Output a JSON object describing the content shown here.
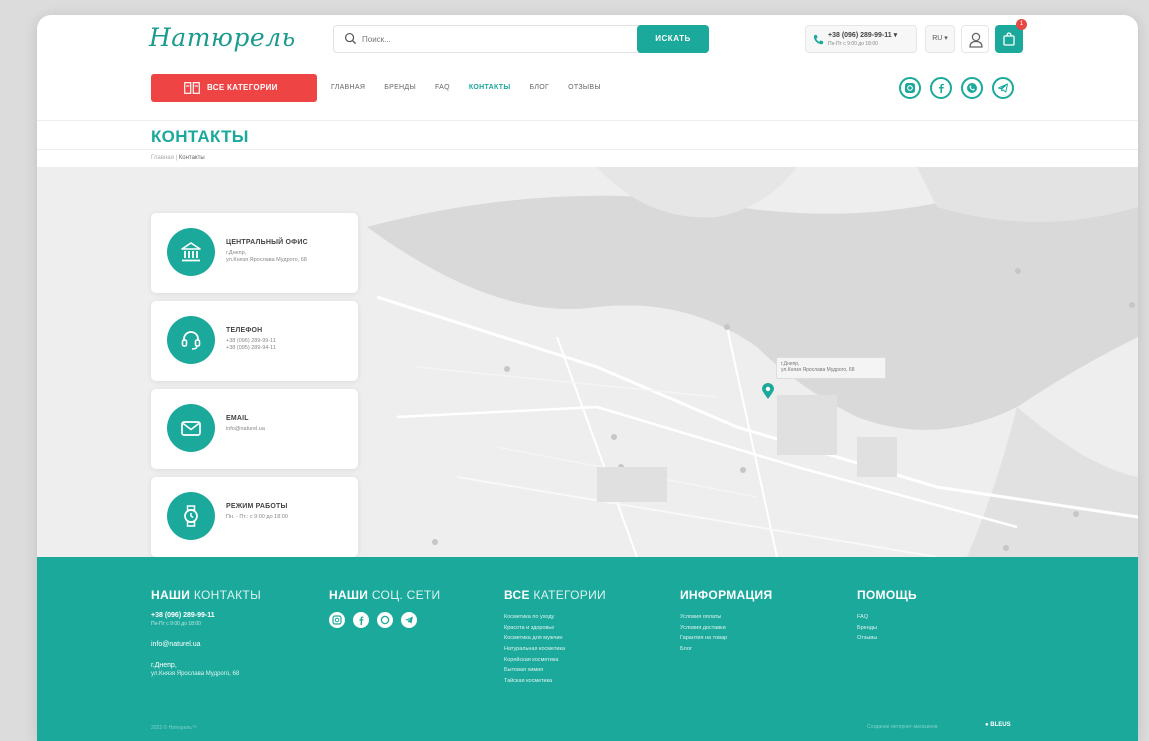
{
  "header": {
    "logo": "Натюрель",
    "search_placeholder": "Поиск...",
    "search_button": "ИСКАТЬ",
    "phone": "+38 (096) 289-99-11 ▾",
    "phone_hours": "Пн-Пт с 9:00 до 18:00",
    "lang": "RU ▾",
    "cart_count": "1"
  },
  "nav": {
    "all_categories": "ВСЕ КАТЕГОРИИ",
    "items": [
      {
        "label": "ГЛАВНАЯ",
        "active": false
      },
      {
        "label": "БРЕНДЫ",
        "active": false
      },
      {
        "label": "FAQ",
        "active": false
      },
      {
        "label": "КОНТАКТЫ",
        "active": true
      },
      {
        "label": "БЛОГ",
        "active": false
      },
      {
        "label": "ОТЗЫВЫ",
        "active": false
      }
    ],
    "social": [
      "instagram-icon",
      "facebook-icon",
      "viber-icon",
      "telegram-icon"
    ]
  },
  "page": {
    "title": "КОНТАКТЫ",
    "breadcrumb_home": "Главная",
    "breadcrumb_sep": " | ",
    "breadcrumb_current": "Контакты"
  },
  "cards": [
    {
      "title": "ЦЕНТРАЛЬНЫЙ ОФИС",
      "lines": [
        "г.Днепр,",
        "ул.Князя Ярослава Мудрого, 68"
      ],
      "icon": "bank-icon"
    },
    {
      "title": "ТЕЛЕФОН",
      "lines": [
        "+38 (096) 289-99-11",
        "+38 (095) 289-94-11"
      ],
      "icon": "headset-icon"
    },
    {
      "title": "EMAIL",
      "lines": [
        "info@naturel.ua"
      ],
      "icon": "mail-icon"
    },
    {
      "title": "РЕЖИМ РАБОТЫ",
      "lines": [
        "Пн. - Пт.: с 9:00 до 18:00"
      ],
      "icon": "watch-icon"
    }
  ],
  "map": {
    "marker_label_1": "г.Днепр,",
    "marker_label_2": "ул.Князя Ярослава Мудрого, 68"
  },
  "footer": {
    "contacts": {
      "title_bold": "НАШИ",
      "title_light": " КОНТАКТЫ",
      "phone": "+38 (096) 289-99-11",
      "hours": "Пн-Пт с 9:00 до 18:00",
      "email": "info@naturel.ua",
      "city": "г.Днепр,",
      "address": "ул.Князя Ярослава Мудрого, 68"
    },
    "social": {
      "title_bold": "НАШИ",
      "title_light": " СОЦ. СЕТИ"
    },
    "categories": {
      "title_bold": "ВСЕ",
      "title_light": " КАТЕГОРИИ",
      "items": [
        "Косметика по уходу",
        "Красота и здоровье",
        "Косметика для мужчин",
        "Натуральная косметика",
        "Корейская косметика",
        "Бытовая химия",
        "Тайская косметика"
      ]
    },
    "info": {
      "title_bold": "ИНФОРМАЦИЯ",
      "items": [
        "Условия оплаты",
        "Условия доставки",
        "Гарантия на товар",
        "Блог"
      ]
    },
    "help": {
      "title_bold": "ПОМОЩЬ",
      "items": [
        "FAQ",
        "Бренды",
        "Отзывы"
      ]
    },
    "copyright": "2022 © Натюрель™",
    "developer": "Создание интернет-магазинов",
    "developer_logo": "● BLEUS"
  },
  "colors": {
    "accent": "#1ba99c",
    "red": "#ef4444"
  }
}
